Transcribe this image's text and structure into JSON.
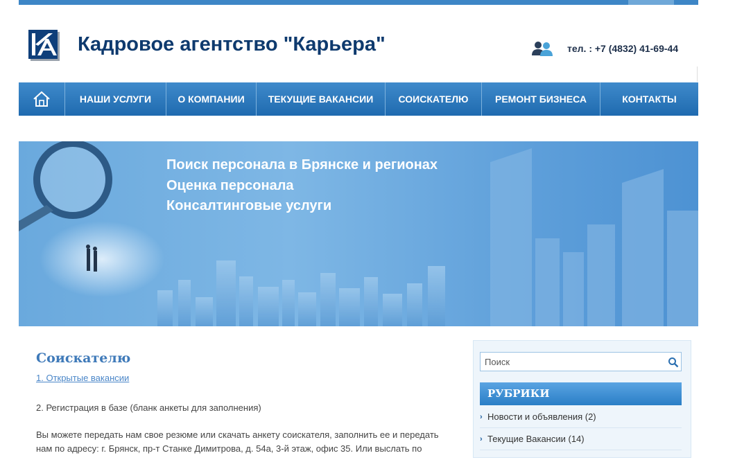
{
  "header": {
    "site_title": "Кадровое агентство \"Карьера\"",
    "phone": "тел. : +7 (4832) 41-69-44"
  },
  "nav": {
    "items": [
      {
        "label": "НАШИ УСЛУГИ"
      },
      {
        "label": "О КОМПАНИИ"
      },
      {
        "label": "ТЕКУЩИЕ ВАКАНСИИ"
      },
      {
        "label": "СОИСКАТЕЛЮ"
      },
      {
        "label": "РЕМОНТ БИЗНЕСА"
      },
      {
        "label": "КОНТАКТЫ"
      }
    ]
  },
  "banner": {
    "lines": [
      "Поиск персонала в Брянске и регионах",
      "Оценка персонала",
      "Консалтинговые услуги"
    ]
  },
  "main": {
    "title": "Соискателю",
    "link1": "1. Открытые вакансии",
    "para1": "2. Регистрация в базе (бланк анкеты для заполнения)",
    "para2": "Вы можете передать нам свое резюме или скачать анкету соискателя, заполнить ее и передать нам по адресу: г. Брянск, пр-т Станке Димитрова, д. 54а, 3-й этаж, офис 35. Или выслать по"
  },
  "sidebar": {
    "search_placeholder": "Поиск",
    "rubriki_title": "РУБРИКИ",
    "categories": [
      {
        "label": "Новости и объявления (2)"
      },
      {
        "label": "Текущие Вакансии (14)"
      }
    ]
  },
  "colors": {
    "brand_dark": "#0e3a6e",
    "nav_blue": "#2a78bd",
    "link_blue": "#4a86c8"
  }
}
